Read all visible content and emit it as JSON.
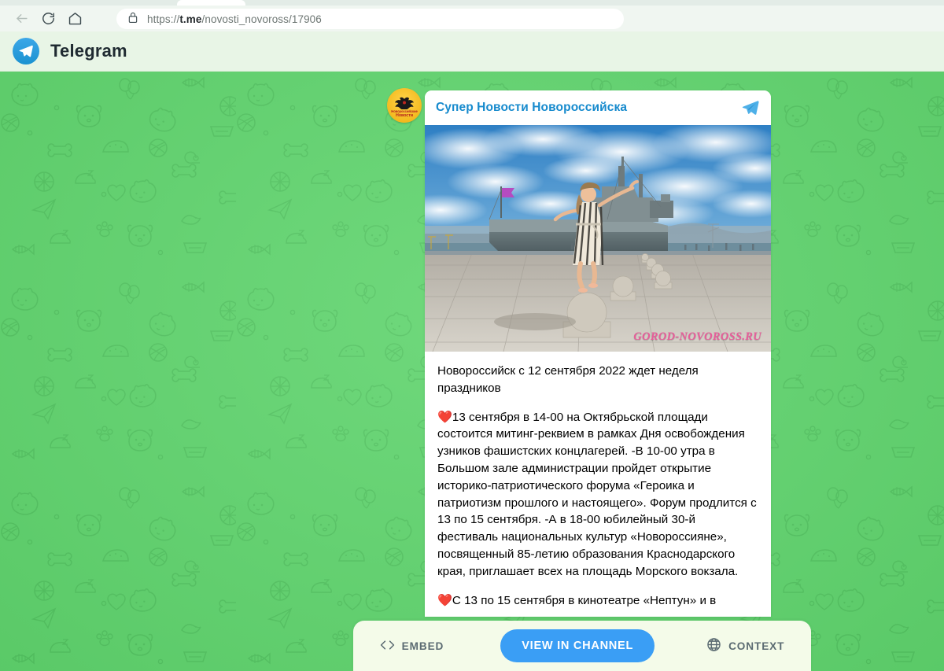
{
  "browser": {
    "url_prefix": "https://",
    "url_domain": "t.me",
    "url_path": "/novosti_novoross/17906",
    "back_icon": "back-arrow-icon",
    "reload_icon": "reload-icon",
    "home_icon": "home-icon",
    "lock_icon": "padlock-icon"
  },
  "site_header": {
    "title": "Telegram",
    "logo_icon": "telegram-plane-logo"
  },
  "post": {
    "channel_name": "Супер Новости Новороссийска",
    "avatar_line1": "Новороссийские",
    "avatar_line2": "Новости",
    "share_icon": "telegram-plane-icon",
    "photo_watermark": "GOROD-NOVOROSS.RU",
    "photo_alt": "Woman balancing on stone sphere at Novorossiysk waterfront with naval cruiser",
    "text": {
      "title": "Новороссийск с 12 сентября 2022 ждет неделя праздников",
      "para1_heart": "❤️",
      "para1": "13 сентября в 14-00 на Октябрьской площади состоится митинг-реквием в рамках Дня освобождения узников фашистских концлагерей.\n-В 10-00 утра в Большом зале администрации пройдет открытие историко-патриотического форума «Героика и патриотизм прошлого и настоящего». Форум продлится с 13 по 15 сентября.\n-А в 18-00 юбилейный 30-й фестиваль национальных культур «Новороссияне», посвященный 85-летию образования Краснодарского края, приглашает всех на площадь Морского вокзала.",
      "para2_heart": "❤️",
      "para2": "С 13 по 15 сентября в кинотеатре «Нептун» и в"
    }
  },
  "action_bar": {
    "embed_label": "EMBED",
    "embed_icon": "code-brackets-icon",
    "view_label": "VIEW IN CHANNEL",
    "context_label": "CONTEXT",
    "context_icon": "globe-icon"
  },
  "colors": {
    "wallpaper_green": "#5fd46d",
    "telegram_blue": "#168ACD",
    "primary_button": "#3a9ef5",
    "header_bg": "#e8f5e6",
    "action_bar_bg": "#f4fbe9",
    "watermark_pink": "#e75d9a"
  }
}
